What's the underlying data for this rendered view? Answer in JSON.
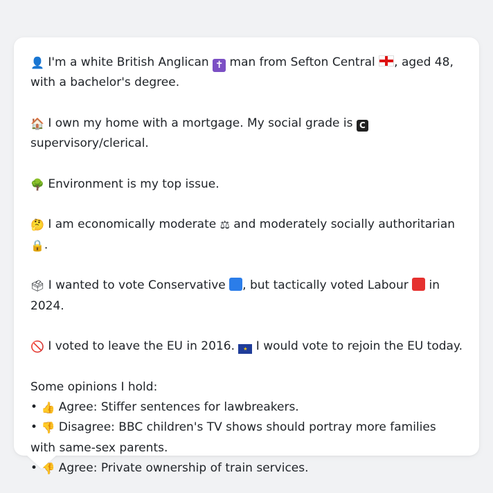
{
  "profile": {
    "identity": {
      "icon": "person-silhouette",
      "text_1": " I'm a white British Anglican ",
      "religion_icon": "latin-cross",
      "text_2": " man from Sefton Central ",
      "flag_icon": "england-flag",
      "text_3": ", aged 48, with a bachelor's degree."
    },
    "housing": {
      "icon": "house",
      "text_1": " I own my home with a mortgage. My social grade is ",
      "grade_letter": "C",
      "text_2": " supervisory/clerical."
    },
    "issue": {
      "icon": "deciduous-tree",
      "text": " Environment is my top issue."
    },
    "ideology": {
      "icon": "thinking-face",
      "text_1": " I am economically moderate ",
      "scales_icon": "balance-scale",
      "text_2": " and moderately socially authoritarian ",
      "lock_icon": "locked-padlock",
      "text_3": "."
    },
    "vote": {
      "icon": "ballot-box",
      "text_1": " I wanted to vote Conservative ",
      "conservative_color": "#2b7de9",
      "text_2": ", but tactically voted Labour ",
      "labour_color": "#e5312f",
      "text_3": " in 2024."
    },
    "brexit": {
      "icon": "prohibited",
      "text_1": " I voted to leave the EU in 2016. ",
      "eu_icon": "eu-flag",
      "text_2": " I would vote to rejoin the EU today."
    },
    "opinions": {
      "heading": "Some opinions I hold:",
      "items": [
        {
          "bullet": "•",
          "icon": "thumbs-up",
          "text": " Agree: Stiffer sentences for lawbreakers."
        },
        {
          "bullet": "•",
          "icon": "thumbs-down",
          "text": " Disagree: BBC children's TV shows should portray more families with same-sex parents."
        },
        {
          "bullet": "•",
          "icon": "thumbs-down",
          "text": " Agree: Private ownership of train services."
        }
      ]
    }
  }
}
